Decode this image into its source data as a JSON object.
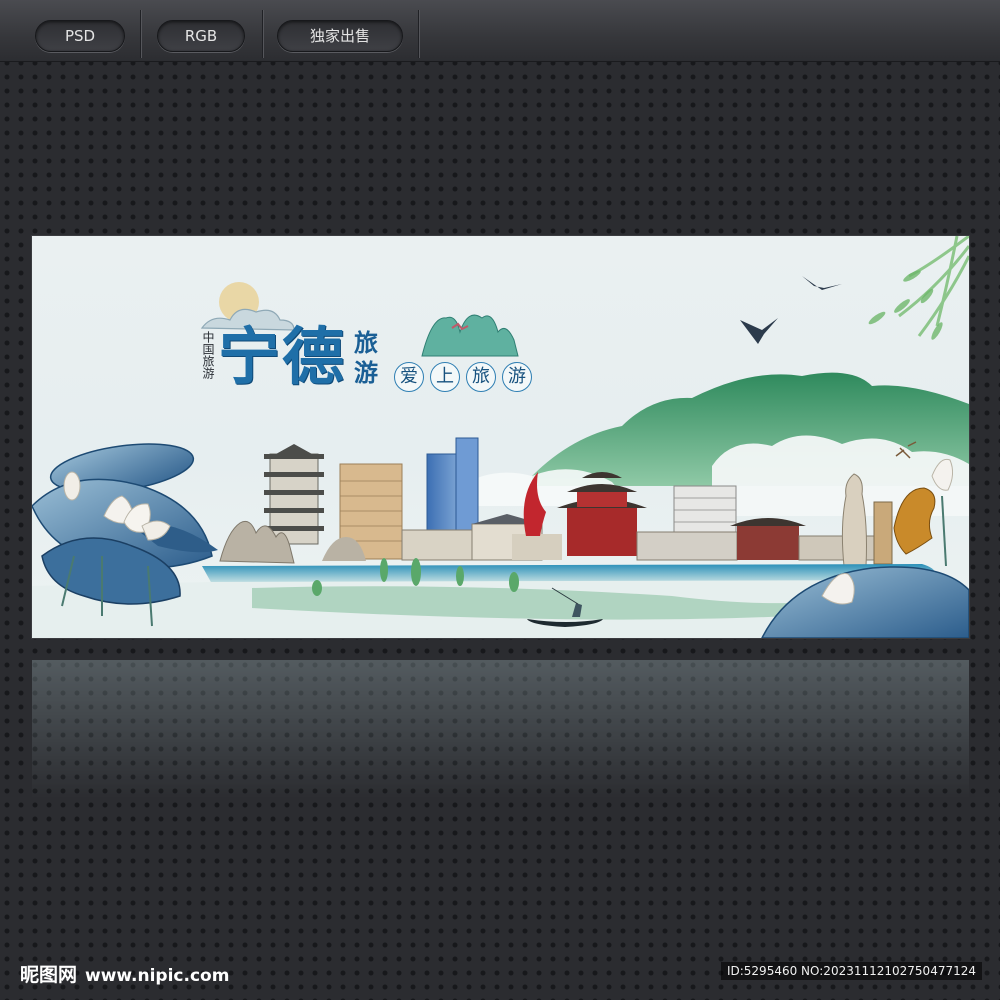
{
  "toolbar": {
    "buttons": [
      {
        "label": "PSD"
      },
      {
        "label": "RGB"
      },
      {
        "label": "独家出售"
      }
    ]
  },
  "poster": {
    "small_title": "中国旅游",
    "main_title": "宁德",
    "side_title": "旅游",
    "slogan": [
      "爱",
      "上",
      "旅",
      "游"
    ],
    "colors": {
      "title_blue": "#1f6fa8",
      "mountain_green": "#3f9a6a",
      "lotus_blue": "#3c6f9c"
    }
  },
  "footer": {
    "brand": "昵图网",
    "url": "www.nipic.com",
    "id_text": "ID:5295460 NO:20231112102750477124"
  }
}
